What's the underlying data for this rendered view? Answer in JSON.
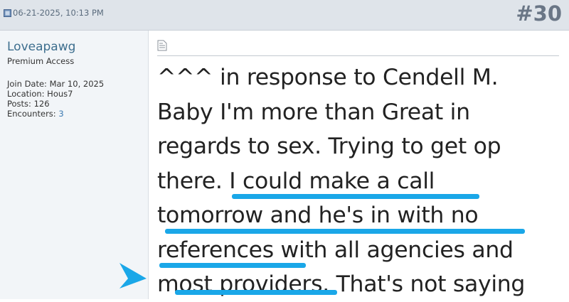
{
  "post": {
    "date": "06-21-2025, 10:13 PM",
    "number": "#30"
  },
  "user": {
    "name": "Loveapawg",
    "title": "Premium Access",
    "join_date": "Join Date: Mar 10, 2025",
    "location": "Location: Hous7",
    "posts": "Posts: 126",
    "encounters_label": "Encounters: ",
    "encounters_value": "3"
  },
  "message": {
    "lines": [
      "^^^ in response to Cendell M.",
      "Baby I'm more than Great in",
      "regards to sex. Trying to get op",
      "there. I could make a call",
      "tomorrow and he's in with no",
      "references with all agencies and",
      "most providers. That's not saying"
    ]
  },
  "annotation_color": "#1aa7e8"
}
